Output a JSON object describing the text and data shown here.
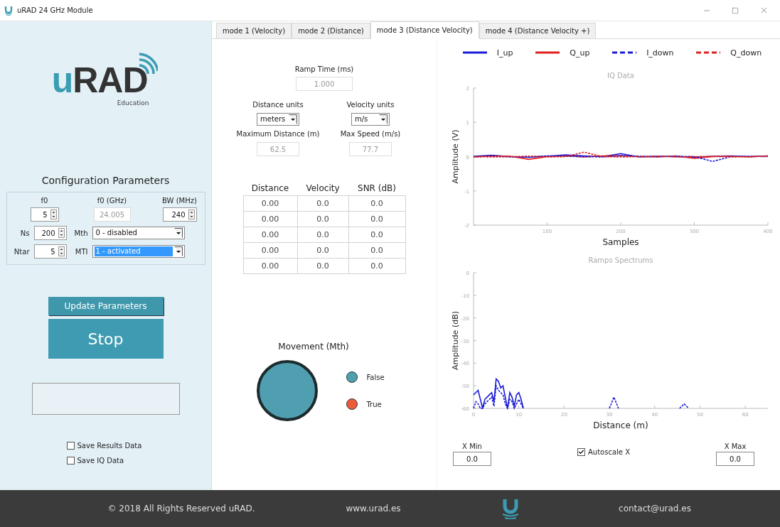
{
  "window": {
    "title": "uRAD 24 GHz Module"
  },
  "logo": {
    "accent": "u",
    "rest": "RAD",
    "tagline": "Education"
  },
  "config": {
    "title": "Configuration Parameters",
    "f0": {
      "label": "f0",
      "value": "5"
    },
    "f0_ghz": {
      "label": "f0 (GHz)",
      "value": "24.005",
      "disabled": true
    },
    "bw": {
      "label": "BW (MHz)",
      "value": "240"
    },
    "ns": {
      "label": "Ns",
      "value": "200"
    },
    "mth": {
      "label": "Mth",
      "value": "0 - disabled",
      "highlighted": false
    },
    "ntar": {
      "label": "Ntar",
      "value": "5"
    },
    "mti": {
      "label": "MTI",
      "value": "1 - activated",
      "highlighted": true
    }
  },
  "buttons": {
    "update": "Update Parameters",
    "stop": "Stop"
  },
  "checkboxes": [
    {
      "label": "Save Results Data",
      "checked": false
    },
    {
      "label": "Save IQ Data",
      "checked": false
    }
  ],
  "tabs": [
    {
      "label": "mode 1 (Velocity)",
      "selected": false
    },
    {
      "label": "mode 2 (Distance)",
      "selected": false
    },
    {
      "label": "mode 3 (Distance Velocity)",
      "selected": true
    },
    {
      "label": "mode 4 (Distance Velocity +)",
      "selected": false
    }
  ],
  "ramp_time": {
    "label": "Ramp Time (ms)",
    "value": "1.000"
  },
  "distance_units": {
    "label": "Distance units",
    "value": "meters"
  },
  "velocity_units": {
    "label": "Velocity units",
    "value": "m/s"
  },
  "max_distance": {
    "label": "Maximum Distance (m)",
    "value": "62.5"
  },
  "max_speed": {
    "label": "Max Speed (m/s)",
    "value": "77.7"
  },
  "results": {
    "columns": [
      "Distance",
      "Velocity",
      "SNR (dB)"
    ],
    "rows": [
      [
        "0.00",
        "0.0",
        "0.0"
      ],
      [
        "0.00",
        "0.0",
        "0.0"
      ],
      [
        "0.00",
        "0.0",
        "0.0"
      ],
      [
        "0.00",
        "0.0",
        "0.0"
      ],
      [
        "0.00",
        "0.0",
        "0.0"
      ]
    ]
  },
  "movement": {
    "label": "Movement (Mth)",
    "active": false,
    "leds": [
      {
        "label": "False",
        "color": "#4f9fb0"
      },
      {
        "label": "True",
        "color": "#ee5a3a"
      }
    ]
  },
  "iq_chart": {
    "chart_data": {
      "type": "line",
      "title": "IQ Data",
      "xlabel": "Samples",
      "ylabel": "Amplitude (V)",
      "legend": "top",
      "x": [
        0,
        25,
        50,
        75,
        100,
        125,
        150,
        175,
        200,
        225,
        250,
        275,
        300,
        325,
        350,
        375,
        400
      ],
      "xlim": [
        0,
        400
      ],
      "ylim": [
        -2,
        2
      ],
      "xticks": [
        100,
        200,
        300,
        400
      ],
      "yticks": [
        -2,
        -1,
        0,
        1,
        2
      ],
      "series": [
        {
          "name": "I_up",
          "color": "#1a1ad8",
          "line_style": "solid",
          "values": [
            0.01,
            0.04,
            0.0,
            -0.02,
            0.01,
            0.05,
            0.02,
            0.0,
            0.09,
            -0.01,
            0.01,
            0.0,
            -0.03,
            0.01,
            0.02,
            0.0,
            0.02
          ]
        },
        {
          "name": "Q_up",
          "color": "#e02020",
          "line_style": "solid",
          "values": [
            -0.01,
            0.02,
            0.01,
            -0.08,
            0.0,
            0.02,
            -0.01,
            0.02,
            0.03,
            0.0,
            -0.01,
            0.02,
            -0.05,
            0.0,
            0.01,
            -0.01,
            0.02
          ]
        },
        {
          "name": "I_down",
          "color": "#1a1ad8",
          "line_style": "dashed",
          "values": [
            0.0,
            0.01,
            -0.01,
            0.0,
            0.02,
            0.01,
            0.0,
            -0.01,
            0.03,
            0.01,
            0.0,
            0.01,
            0.0,
            -0.14,
            0.0,
            0.01,
            0.0
          ]
        },
        {
          "name": "Q_down",
          "color": "#e02020",
          "line_style": "dashed",
          "values": [
            0.0,
            -0.01,
            0.0,
            0.01,
            -0.01,
            0.0,
            0.13,
            0.0,
            -0.01,
            0.0,
            0.01,
            -0.01,
            0.0,
            0.01,
            -0.01,
            0.0,
            0.01
          ]
        }
      ]
    }
  },
  "spectrum_chart": {
    "chart_data": {
      "type": "line",
      "title": "Ramps Spectrums",
      "xlabel": "Distance (m)",
      "ylabel": "Amplitude (dB)",
      "x": [
        0,
        0.5,
        1,
        1.5,
        2,
        2.5,
        3,
        3.5,
        4,
        4.5,
        5,
        5.5,
        6,
        6.5,
        7,
        7.5,
        8,
        8.5,
        9,
        9.5,
        10,
        10.5,
        11,
        20,
        30,
        31,
        32,
        40,
        45.5,
        46.5,
        47.5
      ],
      "xlim": [
        0,
        65
      ],
      "ylim": [
        -60,
        0
      ],
      "xticks": [
        0,
        10,
        20,
        30,
        40,
        50,
        60
      ],
      "yticks": [
        -60,
        -50,
        -40,
        -30,
        -20,
        -10,
        0
      ],
      "series": [
        {
          "color": "#1a1ad8",
          "line_style": "solid",
          "values": [
            -54,
            -53,
            -52,
            -56,
            -60,
            -56,
            -55,
            -54,
            -53,
            -57,
            -47,
            -48,
            -51,
            -50,
            -55,
            -60,
            -53,
            -55,
            -59,
            -54,
            -53,
            -56,
            -60,
            null,
            null,
            null,
            null,
            null,
            null,
            null,
            null
          ]
        },
        {
          "color": "#1a1ad8",
          "line_style": "dashed",
          "values": [
            -60,
            -57,
            -58,
            -60,
            -60,
            -58,
            -57,
            -56,
            -55,
            -59,
            -50,
            -52,
            -53,
            -54,
            -58,
            -60,
            -56,
            -57,
            -60,
            -58,
            -56,
            -58,
            -60,
            null,
            -60,
            -55,
            -60,
            null,
            -60,
            -58,
            -60
          ]
        }
      ]
    }
  },
  "x_range": {
    "min_label": "X Min",
    "min_value": "0.0",
    "autoscale": {
      "label": "Autoscale X",
      "checked": true
    },
    "max_label": "X Max",
    "max_value": "0.0"
  },
  "footer": {
    "copyright": "© 2018 All Rights Reserved uRAD.",
    "website": "www.urad.es",
    "contact": "contact@urad.es"
  }
}
